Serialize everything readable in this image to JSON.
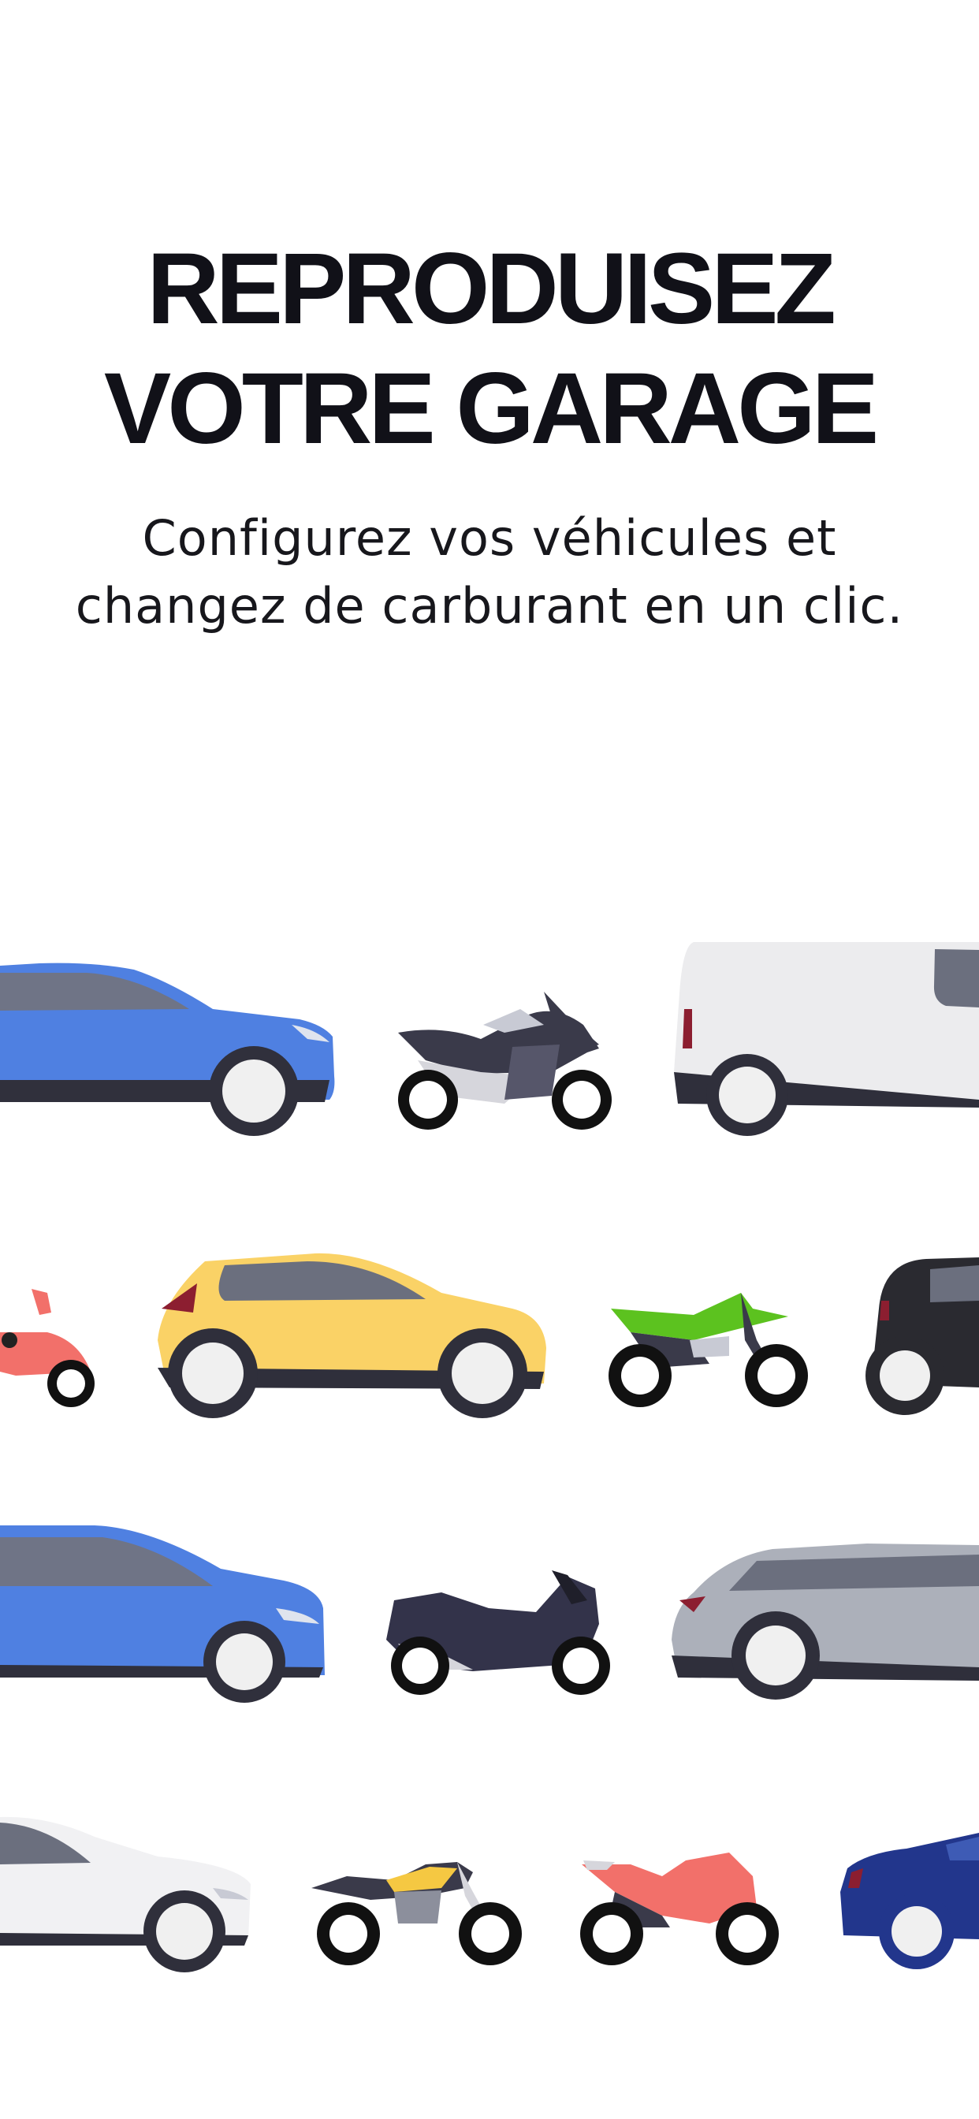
{
  "header": {
    "title_line1": "REPRODUISEZ",
    "title_line2": "VOTRE GARAGE"
  },
  "intro": {
    "subtitle_line1": "Configurez vos véhicules et",
    "subtitle_line2": "changez de carburant en un clic."
  },
  "illustration": {
    "vehicles": [
      {
        "kind": "suv",
        "color": "#4f80e1"
      },
      {
        "kind": "adventure-motorcycle",
        "color": "#3a3a4a"
      },
      {
        "kind": "van",
        "color": "#ececee"
      },
      {
        "kind": "scooter",
        "color": "#f2706a"
      },
      {
        "kind": "hatchback",
        "color": "#fad266"
      },
      {
        "kind": "dirt-bike",
        "color": "#5cc21f"
      },
      {
        "kind": "city-car",
        "color": "#2a2a30"
      },
      {
        "kind": "wagon",
        "color": "#4f80e1"
      },
      {
        "kind": "maxi-scooter",
        "color": "#33334a"
      },
      {
        "kind": "estate-car",
        "color": "#acb0ba"
      },
      {
        "kind": "sedan",
        "color": "#f1f1f3"
      },
      {
        "kind": "roadster-motorcycle",
        "color": "#f5c842"
      },
      {
        "kind": "sport-motorcycle",
        "color": "#f2706a"
      },
      {
        "kind": "compact-car",
        "color": "#22368c"
      }
    ]
  }
}
